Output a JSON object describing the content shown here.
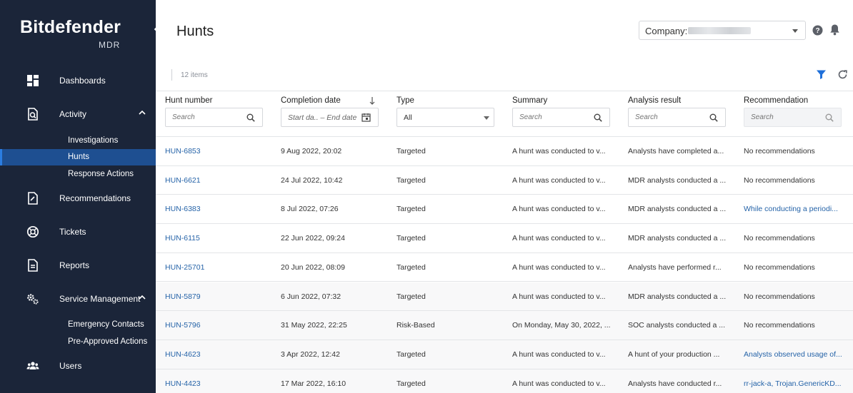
{
  "brand": {
    "name": "Bitdefender",
    "product": "MDR"
  },
  "sidebar": {
    "items": [
      {
        "id": "dashboards",
        "label": "Dashboards"
      },
      {
        "id": "activity",
        "label": "Activity",
        "sub": [
          "Investigations",
          "Hunts",
          "Response Actions"
        ]
      },
      {
        "id": "recommendations",
        "label": "Recommendations"
      },
      {
        "id": "tickets",
        "label": "Tickets"
      },
      {
        "id": "reports",
        "label": "Reports"
      },
      {
        "id": "service",
        "label": "Service Management",
        "sub": [
          "Emergency Contacts",
          "Pre-Approved Actions"
        ]
      },
      {
        "id": "users",
        "label": "Users"
      }
    ],
    "active_sub": "Hunts"
  },
  "header": {
    "title": "Hunts",
    "company_label": "Company: K"
  },
  "toolbar": {
    "items_count": "12 items"
  },
  "table": {
    "columns": [
      "Hunt number",
      "Completion date",
      "Type",
      "Summary",
      "Analysis result",
      "Recommendation"
    ],
    "filters": {
      "hunt_number": "Search",
      "completion_date": "Start da.. – End date",
      "type": "All",
      "summary": "Search",
      "analysis": "Search",
      "recommendation": "Search"
    },
    "rows": [
      [
        "HUN-6853",
        "9 Aug 2022, 20:02",
        "Targeted",
        "A hunt was conducted to v...",
        "Analysts have completed a...",
        "No recommendations"
      ],
      [
        "HUN-6621",
        "24 Jul 2022, 10:42",
        "Targeted",
        "A hunt was conducted to v...",
        "MDR analysts conducted a ...",
        "No recommendations"
      ],
      [
        "HUN-6383",
        "8 Jul 2022, 07:26",
        "Targeted",
        "A hunt was conducted to v...",
        "MDR analysts conducted a ...",
        "While conducting a periodi..."
      ],
      [
        "HUN-6115",
        "22 Jun 2022, 09:24",
        "Targeted",
        "A hunt was conducted to v...",
        "MDR analysts conducted a ...",
        "No recommendations"
      ],
      [
        "HUN-25701",
        "20 Jun 2022, 08:09",
        "Targeted",
        "A hunt was conducted to v...",
        "Analysts have performed r...",
        "No recommendations"
      ],
      [
        "HUN-5879",
        "6 Jun 2022, 07:32",
        "Targeted",
        "A hunt was conducted to v...",
        "MDR analysts conducted a ...",
        "No recommendations"
      ],
      [
        "HUN-5796",
        "31 May 2022, 22:25",
        "Risk-Based",
        "On Monday, May 30, 2022, ...",
        "SOC analysts conducted a ...",
        "No recommendations"
      ],
      [
        "HUN-4623",
        "3 Apr 2022, 12:42",
        "Targeted",
        "A hunt was conducted to v...",
        "A hunt of your production ...",
        "Analysts observed usage of..."
      ],
      [
        "HUN-4423",
        "17 Mar 2022, 16:10",
        "Targeted",
        "A hunt was conducted to v...",
        "Analysts have conducted r...",
        "rr-jack-a, Trojan.GenericKD..."
      ]
    ],
    "rec_links": [
      false,
      false,
      true,
      false,
      false,
      false,
      false,
      true,
      true
    ]
  },
  "colors": {
    "sidebar": "#1b2539",
    "active": "#1e4f91",
    "link": "#2563a8"
  }
}
